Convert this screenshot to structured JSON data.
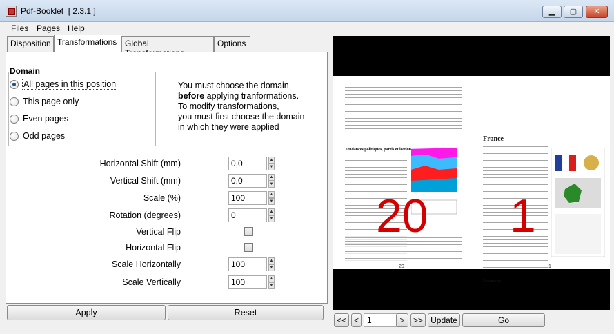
{
  "window": {
    "title": "Pdf-Booklet",
    "version": "[ 2.3.1 ]",
    "minimize": "▁",
    "maximize": "▢",
    "close": "✕"
  },
  "menu": {
    "files": "Files",
    "pages": "Pages",
    "help": "Help"
  },
  "tabs": [
    {
      "label": "Disposition"
    },
    {
      "label": "Transformations"
    },
    {
      "label": "Global Transformations"
    },
    {
      "label": "Options"
    }
  ],
  "domain": {
    "title": "Domain",
    "options": [
      {
        "label": "All pages in this position",
        "checked": true
      },
      {
        "label": "This page only",
        "checked": false
      },
      {
        "label": "Even pages",
        "checked": false
      },
      {
        "label": "Odd pages",
        "checked": false
      }
    ],
    "note_line1": "You must choose the domain",
    "note_bold": "before",
    "note_line2_rest": " applying tranformations.",
    "note_line3": "To modify transformations,",
    "note_line4": "you must first choose the domain",
    "note_line5": "in which they were applied"
  },
  "fields": {
    "h_shift_label": "Horizontal Shift (mm)",
    "h_shift_value": "0,0",
    "v_shift_label": "Vertical Shift (mm)",
    "v_shift_value": "0,0",
    "scale_label": "Scale (%)",
    "scale_value": "100",
    "rotation_label": "Rotation (degrees)",
    "rotation_value": "0",
    "v_flip_label": "Vertical Flip",
    "h_flip_label": "Horizontal Flip",
    "scale_h_label": "Scale Horizontally",
    "scale_h_value": "100",
    "scale_v_label": "Scale Vertically",
    "scale_v_value": "100"
  },
  "buttons": {
    "apply": "Apply",
    "reset": "Reset"
  },
  "preview": {
    "left_page_number": "20",
    "right_page_number": "1",
    "left_footer": "20",
    "right_footer": "1",
    "right_heading": "France",
    "left_subheading": "Tendances politiques, partis et lections",
    "right_subheading": "Sommaire"
  },
  "nav": {
    "first": "<<",
    "prev": "<",
    "page_value": "1",
    "next": ">",
    "last": ">>",
    "update": "Update",
    "go": "Go"
  }
}
